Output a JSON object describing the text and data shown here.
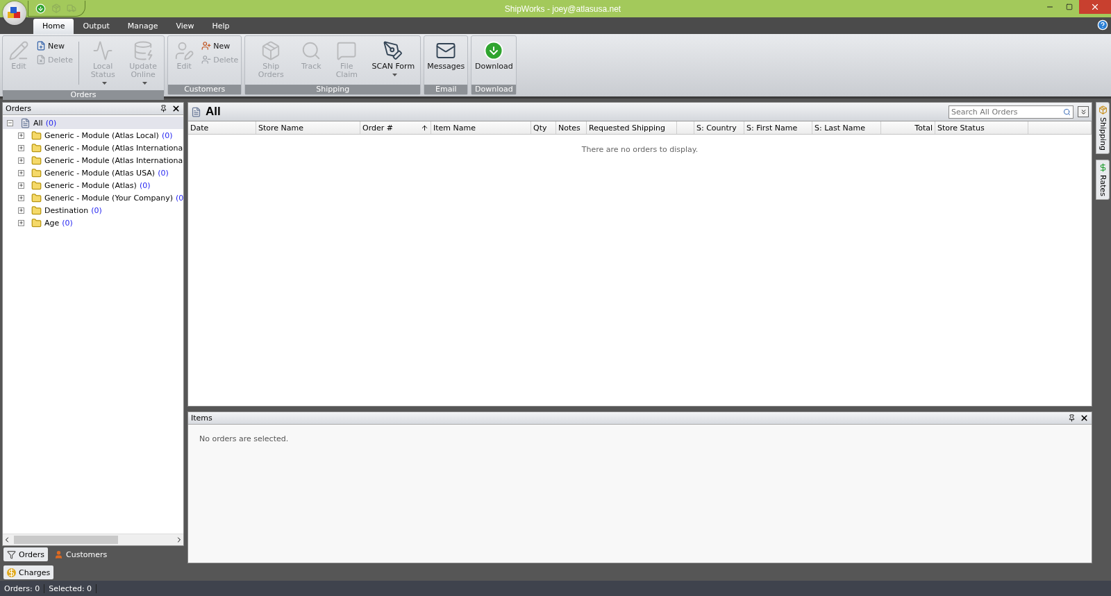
{
  "window": {
    "title": "ShipWorks - joey@atlasusa.net"
  },
  "menu_tabs": [
    {
      "label": "Home",
      "selected": true
    },
    {
      "label": "Output",
      "selected": false
    },
    {
      "label": "Manage",
      "selected": false
    },
    {
      "label": "View",
      "selected": false
    },
    {
      "label": "Help",
      "selected": false
    }
  ],
  "ribbon": {
    "groups": [
      {
        "label": "Orders",
        "items": [
          {
            "kind": "large",
            "label": "Edit",
            "disabled": true,
            "dropdown": false
          },
          {
            "kind": "stack",
            "buttons": [
              {
                "label": "New",
                "disabled": false
              },
              {
                "label": "Delete",
                "disabled": true
              }
            ]
          },
          {
            "kind": "separator"
          },
          {
            "kind": "large",
            "label": "Local Status",
            "disabled": true,
            "dropdown": true
          },
          {
            "kind": "large",
            "label": "Update Online",
            "disabled": true,
            "dropdown": true
          }
        ]
      },
      {
        "label": "Customers",
        "items": [
          {
            "kind": "large",
            "label": "Edit",
            "disabled": true,
            "dropdown": false
          },
          {
            "kind": "stack",
            "buttons": [
              {
                "label": "New",
                "disabled": false
              },
              {
                "label": "Delete",
                "disabled": true
              }
            ]
          }
        ]
      },
      {
        "label": "Shipping",
        "items": [
          {
            "kind": "large",
            "label": "Ship Orders",
            "disabled": true,
            "dropdown": false
          },
          {
            "kind": "large",
            "label": "Track",
            "disabled": true,
            "dropdown": false
          },
          {
            "kind": "large",
            "label": "File Claim",
            "disabled": true,
            "dropdown": false
          },
          {
            "kind": "large",
            "label": "SCAN Form",
            "disabled": false,
            "dropdown": true
          }
        ]
      },
      {
        "label": "Email",
        "items": [
          {
            "kind": "large",
            "label": "Messages",
            "disabled": false,
            "dropdown": false
          }
        ]
      },
      {
        "label": "Download",
        "items": [
          {
            "kind": "large",
            "label": "Download",
            "disabled": false,
            "dropdown": false
          }
        ]
      }
    ]
  },
  "orders_pane": {
    "title": "Orders",
    "tree": [
      {
        "label": "All",
        "count": "(0)",
        "expanded": true,
        "selected": true,
        "children": [
          {
            "label": "Generic - Module (Atlas Local)",
            "count": "(0)",
            "expanded": false,
            "selected": false
          },
          {
            "label": "Generic - Module (Atlas Internationa",
            "expanded": false,
            "selected": false
          },
          {
            "label": "Generic - Module (Atlas Internationa",
            "expanded": false,
            "selected": false
          },
          {
            "label": "Generic - Module (Atlas USA)",
            "count": "(0)",
            "expanded": false,
            "selected": false
          },
          {
            "label": "Generic - Module (Atlas)",
            "count": "(0)",
            "expanded": false,
            "selected": false
          },
          {
            "label": "Generic - Module (Your Company)",
            "count": "(0",
            "expanded": false,
            "selected": false
          },
          {
            "label": "Destination",
            "count": "(0)",
            "expanded": false,
            "selected": false
          },
          {
            "label": "Age",
            "count": "(0)",
            "expanded": false,
            "selected": false
          }
        ]
      }
    ]
  },
  "pane_tabs": [
    {
      "label": "Orders",
      "selected": true
    },
    {
      "label": "Customers",
      "selected": false
    }
  ],
  "charges_tab": {
    "label": "Charges"
  },
  "grid": {
    "title": "All",
    "search": {
      "placeholder": "Search All Orders"
    },
    "columns": [
      {
        "label": "Date",
        "kind": "text",
        "sorted": false
      },
      {
        "label": "Store Name",
        "kind": "text",
        "sorted": false
      },
      {
        "label": "Order #",
        "kind": "text",
        "sorted": true
      },
      {
        "label": "Item Name",
        "kind": "text",
        "sorted": false
      },
      {
        "label": "Qty",
        "kind": "text",
        "sorted": false
      },
      {
        "label": "Notes",
        "kind": "text",
        "sorted": false
      },
      {
        "label": "Requested Shipping",
        "kind": "text",
        "sorted": false
      },
      {
        "label": "S: Country",
        "kind": "text",
        "sorted": false
      },
      {
        "label": "S: First Name",
        "kind": "text",
        "sorted": false
      },
      {
        "label": "S: Last Name",
        "kind": "text",
        "sorted": false
      },
      {
        "label": "Total",
        "kind": "number",
        "sorted": false
      },
      {
        "label": "Store Status",
        "kind": "text",
        "sorted": false
      }
    ],
    "empty_message": "There are no orders to display."
  },
  "items_pane": {
    "title": "Items",
    "message": "No orders are selected."
  },
  "side_tabs": [
    {
      "label": "Shipping"
    },
    {
      "label": "Rates"
    }
  ],
  "status_bar": [
    "Orders: 0",
    "Selected: 0"
  ]
}
